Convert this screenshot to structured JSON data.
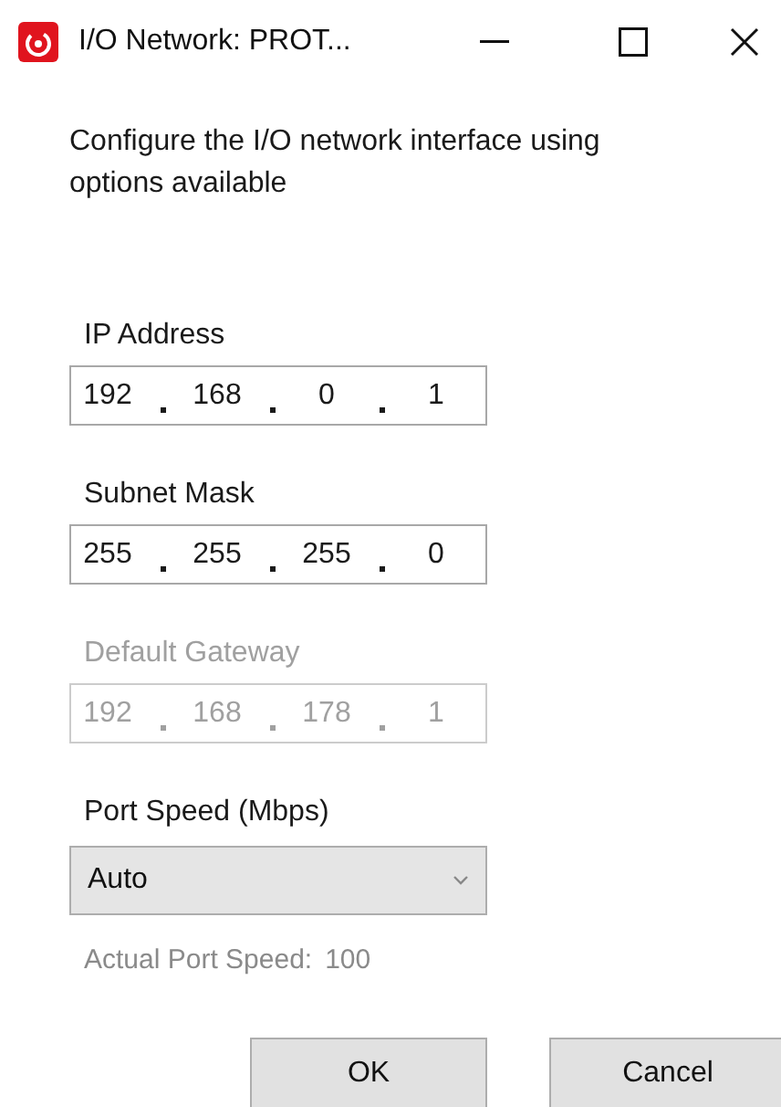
{
  "window": {
    "title": "I/O Network: PROT..."
  },
  "description": "Configure the I/O network interface using options available",
  "fields": [
    {
      "label": "IP Address",
      "octets": [
        "192",
        "168",
        "0",
        "1"
      ],
      "disabled": false
    },
    {
      "label": "Subnet Mask",
      "octets": [
        "255",
        "255",
        "255",
        "0"
      ],
      "disabled": false
    },
    {
      "label": "Default Gateway",
      "octets": [
        "192",
        "168",
        "178",
        "1"
      ],
      "disabled": true
    }
  ],
  "port_speed": {
    "label": "Port Speed (Mbps)",
    "value": "Auto"
  },
  "actual_speed": {
    "label": "Actual Port Speed:",
    "value": "100"
  },
  "buttons": [
    "OK",
    "Cancel"
  ]
}
